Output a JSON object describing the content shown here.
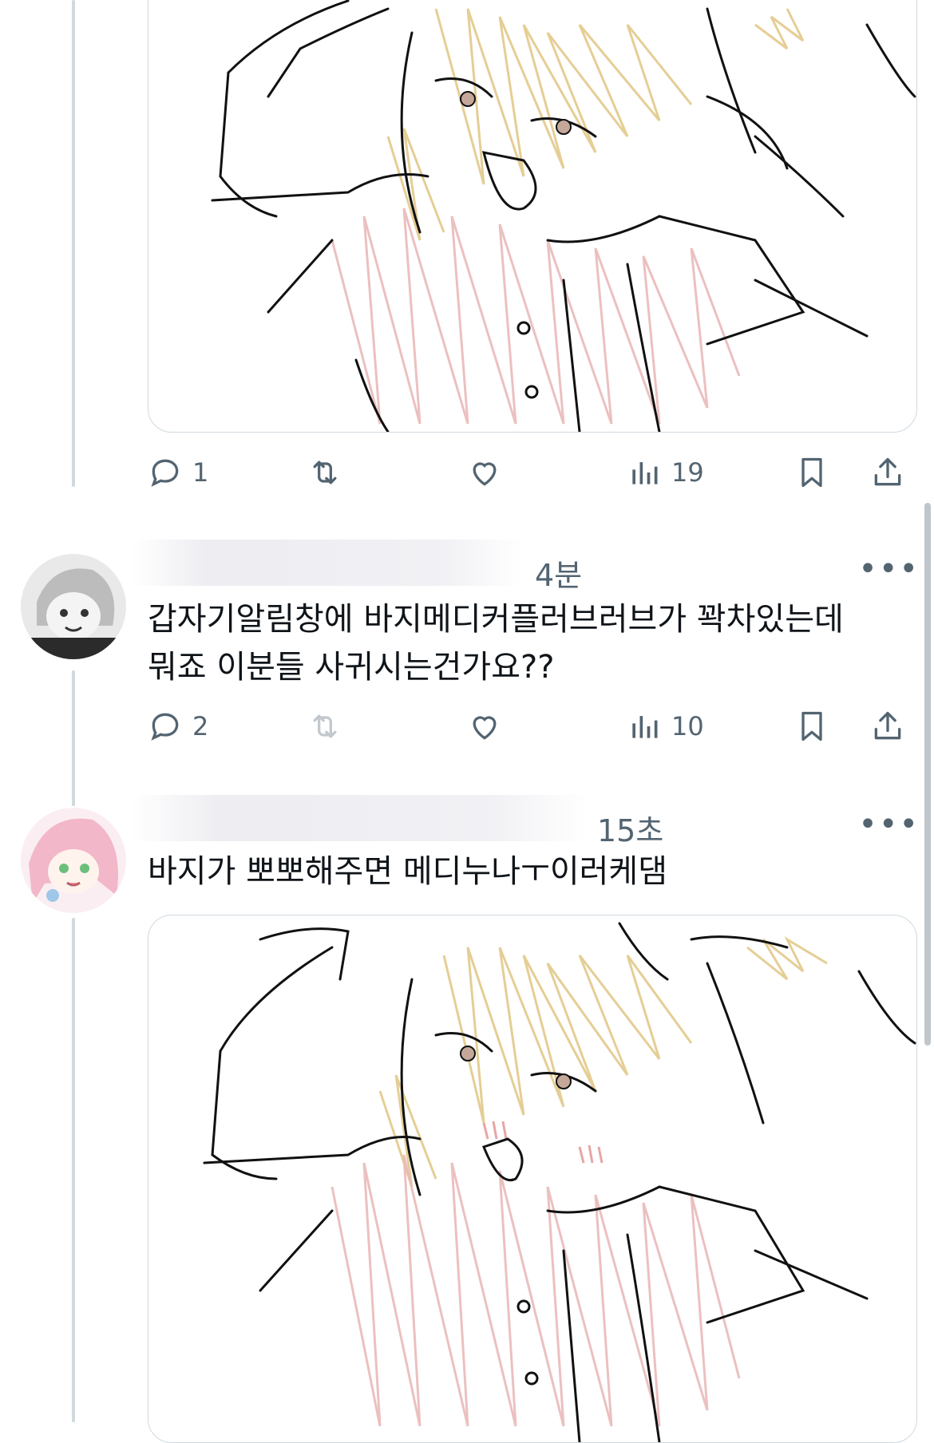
{
  "first_post": {
    "stats": {
      "replies": "1",
      "views": "19"
    }
  },
  "reply_one": {
    "time": "4분",
    "text_line1": "갑자기알림창에 바지메디커플러브러브가 꽉차있는데",
    "text_line2": "뭐죠 이분들 사귀시는건가요??",
    "stats": {
      "replies": "2",
      "views": "10"
    },
    "more_label": "•••"
  },
  "reply_two": {
    "time": "15초",
    "text": "바지가 뽀뽀해주면 메디누나ㅜ이러케댐",
    "more_label": "•••"
  },
  "colors": {
    "text_primary": "#0f1419",
    "text_secondary": "#536471",
    "border": "#cfd9de",
    "hair_scribble": "#e2c98a",
    "shirt_scribble": "#eab9b9"
  },
  "icons": [
    "reply-icon",
    "retweet-icon",
    "like-icon",
    "views-icon",
    "bookmark-icon",
    "share-icon",
    "more-icon"
  ]
}
